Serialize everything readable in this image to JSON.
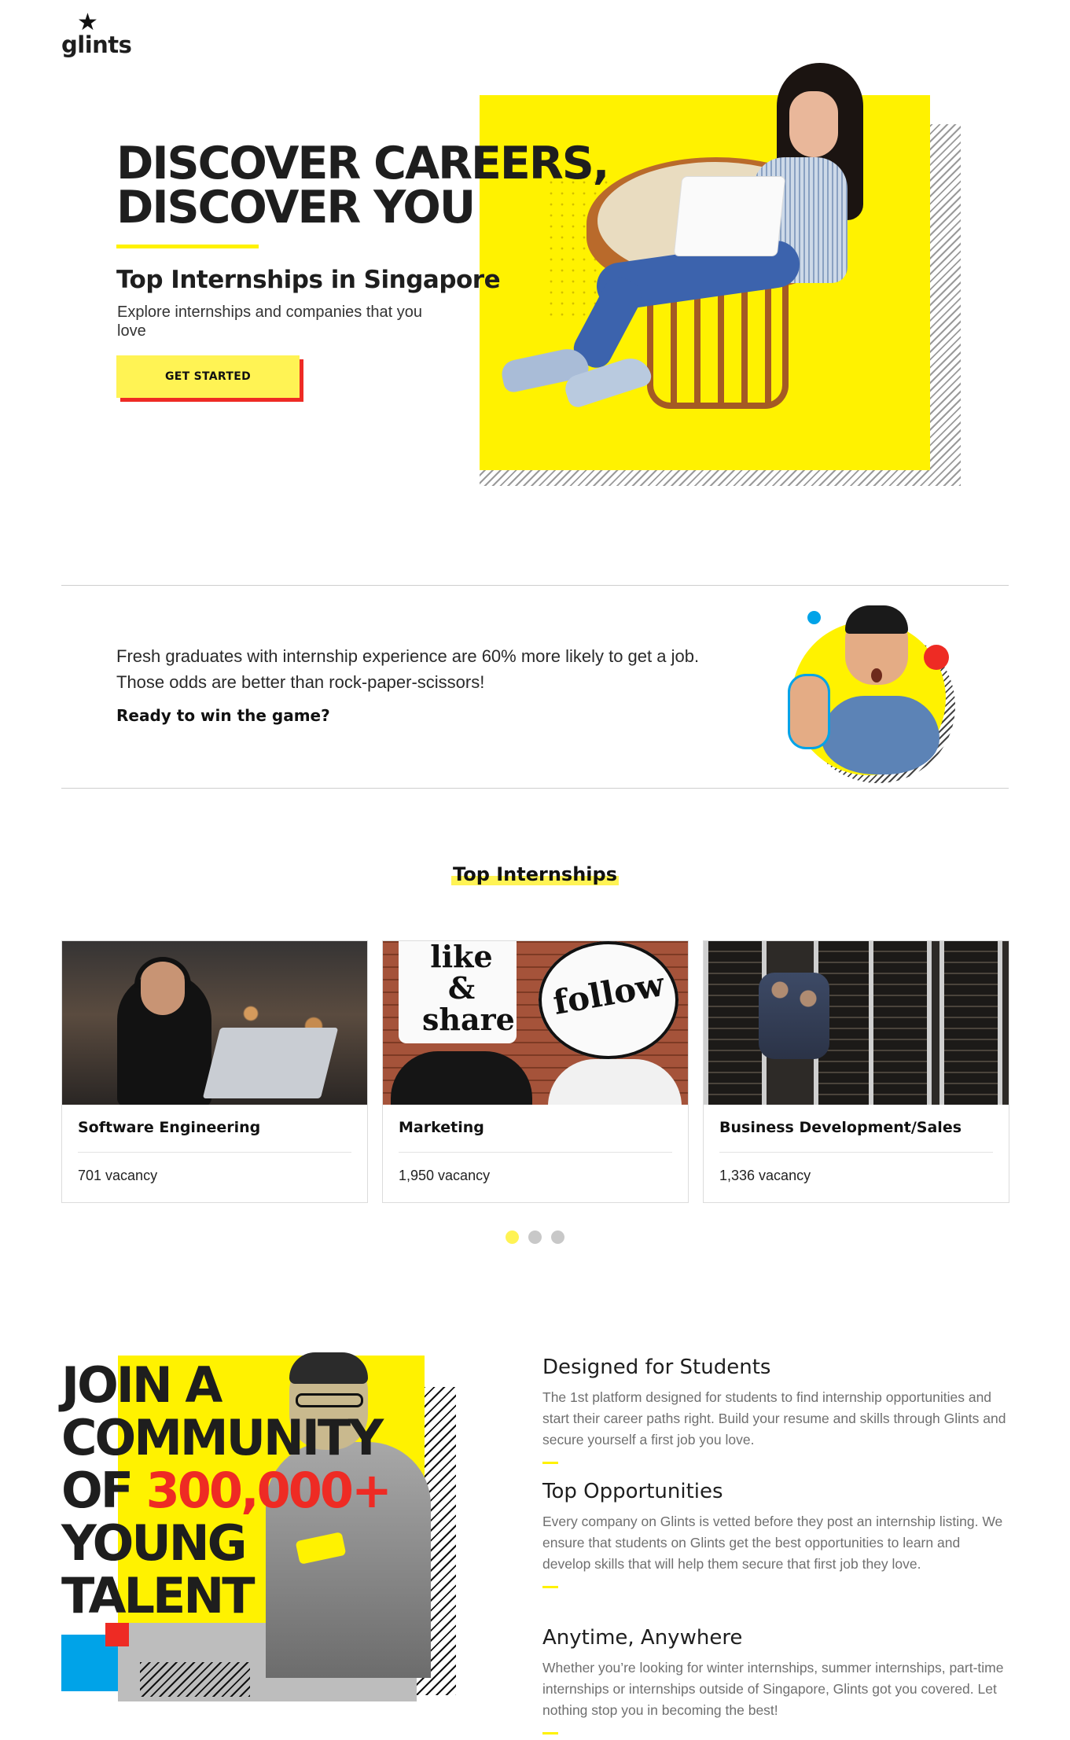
{
  "brand": {
    "logo_text": "glints"
  },
  "hero": {
    "title_line1": "DISCOVER CAREERS,",
    "title_line2": "DISCOVER YOU",
    "subtitle": "Top Internships in Singapore",
    "description": "Explore internships and companies that you love",
    "cta_label": "GET STARTED"
  },
  "info": {
    "line1": "Fresh graduates with internship experience are 60% more likely to get a job.",
    "line2": "Those odds are better than rock-paper-scissors!",
    "cta": "Ready to win the game?"
  },
  "top_internships": {
    "heading": "Top Internships",
    "cards": [
      {
        "title": "Software Engineering",
        "vacancy": "701 vacancy"
      },
      {
        "title": "Marketing",
        "vacancy": "1,950 vacancy",
        "sign_text": "like & share",
        "bubble_text": "follow"
      },
      {
        "title": "Business Development/Sales",
        "vacancy": "1,336 vacancy"
      }
    ],
    "pagination": {
      "total": 3,
      "active": 1
    }
  },
  "community": {
    "line1": "JOIN A",
    "line2": "COMMUNITY",
    "line3_prefix": "OF ",
    "line3_number": "300,000+",
    "line4": "YOUNG",
    "line5": "TALENT"
  },
  "features": [
    {
      "title": "Designed for Students",
      "text": "The 1st platform designed for students to find internship opportunities and start their career paths right. Build your resume and skills through Glints and secure yourself a first job you love."
    },
    {
      "title": "Top Opportunities",
      "text": "Every company on Glints is vetted before they post an internship listing. We ensure that students on Glints get the best opportunities to learn and develop skills that will help them secure that first job they love."
    },
    {
      "title": "Anytime, Anywhere",
      "text": "Whether you’re looking for winter internships, summer internships, part-time internships or internships outside of Singapore, Glints got you covered. Let nothing stop you in becoming the best!"
    }
  ],
  "colors": {
    "accent_yellow": "#fff200",
    "accent_red": "#ee2b24",
    "accent_blue": "#00a3e8",
    "text_dark": "#1e1e1e"
  },
  "icons": {
    "logo_star": "star-icon"
  }
}
